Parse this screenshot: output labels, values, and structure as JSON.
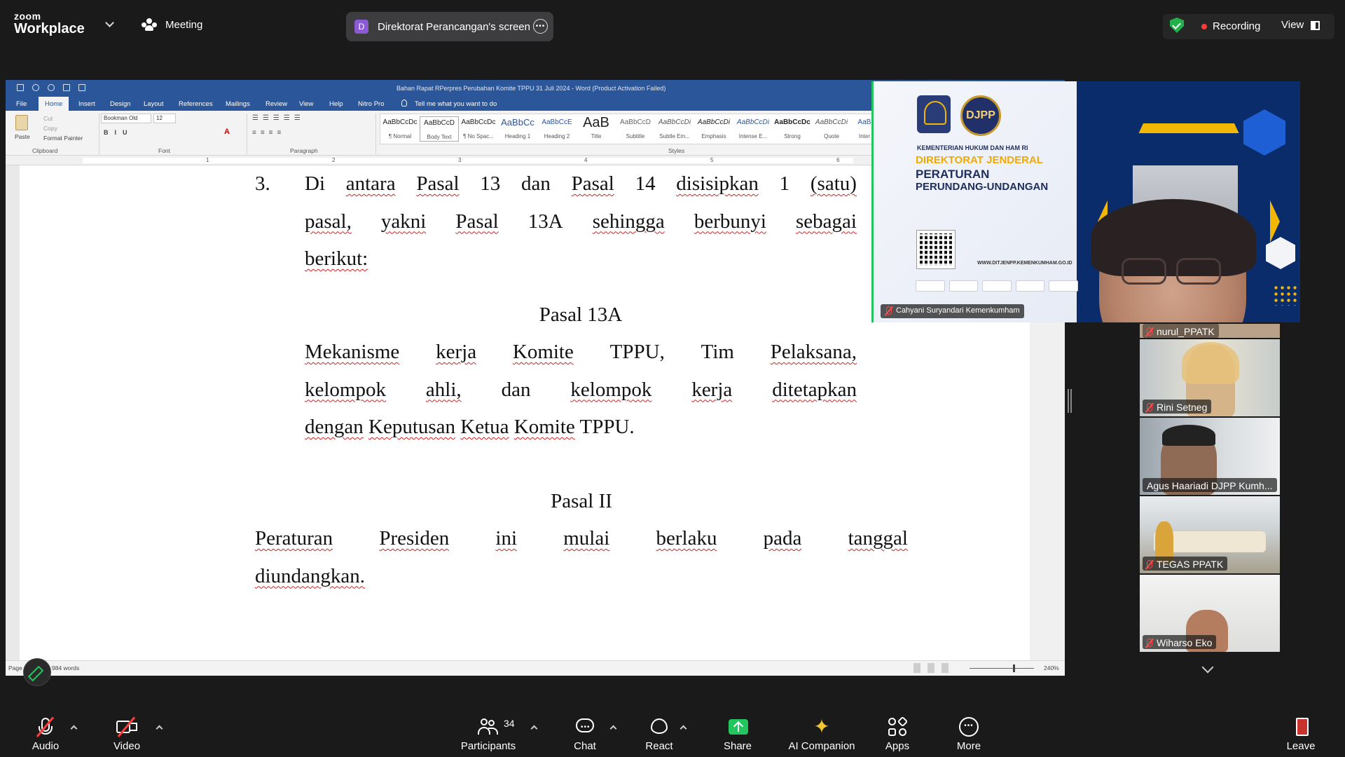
{
  "topbar": {
    "brand_small": "zoom",
    "brand_big": "Workplace",
    "meeting_label": "Meeting",
    "screen_badge": "D",
    "screen_label": "Direktorat Perancangan's screen",
    "recording_label": "Recording",
    "view_label": "View"
  },
  "word": {
    "window_title": "Bahan Rapat RPerpres Perubahan Komite TPPU 31 Juli 2024  -  Word (Product Activation Failed)",
    "tabs": [
      "File",
      "Home",
      "Insert",
      "Design",
      "Layout",
      "References",
      "Mailings",
      "Review",
      "View",
      "Help",
      "Nitro Pro"
    ],
    "tell_me": "Tell me what you want to do",
    "clipboard": {
      "paste": "Paste",
      "cut": "Cut",
      "copy": "Copy",
      "format_painter": "Format Painter",
      "group": "Clipboard"
    },
    "font": {
      "name": "Bookman Old",
      "size": "12",
      "group": "Font"
    },
    "paragraph_group": "Paragraph",
    "styles_group": "Styles",
    "styles": [
      {
        "preview": "AaBbCcDc",
        "name": "¶ Normal"
      },
      {
        "preview": "AaBbCcD",
        "name": "Body Text"
      },
      {
        "preview": "AaBbCcDc",
        "name": "¶ No Spac..."
      },
      {
        "preview": "AaBbCc",
        "name": "Heading 1"
      },
      {
        "preview": "AaBbCcE",
        "name": "Heading 2"
      },
      {
        "preview": "AaB",
        "name": "Title"
      },
      {
        "preview": "AaBbCcD",
        "name": "Subtitle"
      },
      {
        "preview": "AaBbCcDi",
        "name": "Subtle Em..."
      },
      {
        "preview": "AaBbCcDi",
        "name": "Emphasis"
      },
      {
        "preview": "AaBbCcDi",
        "name": "Intense E..."
      },
      {
        "preview": "AaBbCcDc",
        "name": "Strong"
      },
      {
        "preview": "AaBbCcDi",
        "name": "Quote"
      },
      {
        "preview": "AaB",
        "name": "Inter"
      }
    ],
    "ruler_numbers": [
      "1",
      "2",
      "3",
      "4",
      "5",
      "6"
    ],
    "status": {
      "page": "Page",
      "words": "984 words",
      "zoom": "240%"
    },
    "doc": {
      "item_number": "3.",
      "item_lines": [
        [
          "Di",
          "antara",
          "Pasal",
          "13",
          "dan",
          "Pasal",
          "14",
          "disisipkan",
          "1",
          "(satu)"
        ],
        [
          "pasal,",
          "yakni",
          "Pasal",
          "13A",
          "sehingga",
          "berbunyi",
          "sebagai"
        ],
        [
          "berikut:"
        ]
      ],
      "pasal13a_heading": "Pasal 13A",
      "pasal13a_lines": [
        [
          "Mekanisme",
          "kerja",
          "Komite",
          "TPPU,",
          "Tim",
          "Pelaksana,"
        ],
        [
          "kelompok",
          "ahli,",
          "dan",
          "kelompok",
          "kerja",
          "ditetapkan"
        ],
        [
          "dengan",
          "Keputusan",
          "Ketua",
          "Komite",
          "TPPU."
        ]
      ],
      "pasal2_heading": "Pasal II",
      "pasal2_lines": [
        [
          "Peraturan",
          "Presiden",
          "ini",
          "mulai",
          "berlaku",
          "pada",
          "tanggal"
        ],
        [
          "diundangkan."
        ]
      ]
    }
  },
  "speaker": {
    "name": "Cahyani Suryandari Kemenkumham",
    "bg_ministry": "KEMENTERIAN HUKUM DAN HAM RI",
    "bg_dirjen": "DIREKTORAT JENDERAL",
    "bg_pp1": "PERATURAN",
    "bg_pp2": "PERUNDANG-UNDANGAN",
    "bg_logo": "DJPP",
    "bg_url": "WWW.DITJENPP.KEMENKUMHAM.GO.ID"
  },
  "gallery": [
    {
      "name": "nurul_PPATK"
    },
    {
      "name": "Rini Setneg"
    },
    {
      "name": "Agus Haariadi DJPP Kumh..."
    },
    {
      "name": "TEGAS PPATK"
    },
    {
      "name": "Wiharso Eko"
    }
  ],
  "toolbar": {
    "audio": "Audio",
    "video": "Video",
    "participants": "Participants",
    "participants_count": "34",
    "chat": "Chat",
    "react": "React",
    "share": "Share",
    "ai_companion": "AI Companion",
    "apps": "Apps",
    "more": "More",
    "leave": "Leave"
  },
  "colors": {
    "word_blue": "#2b579a",
    "share_green": "#22c55e",
    "recording_red": "#ff3b3b",
    "gold": "#f2b705"
  }
}
